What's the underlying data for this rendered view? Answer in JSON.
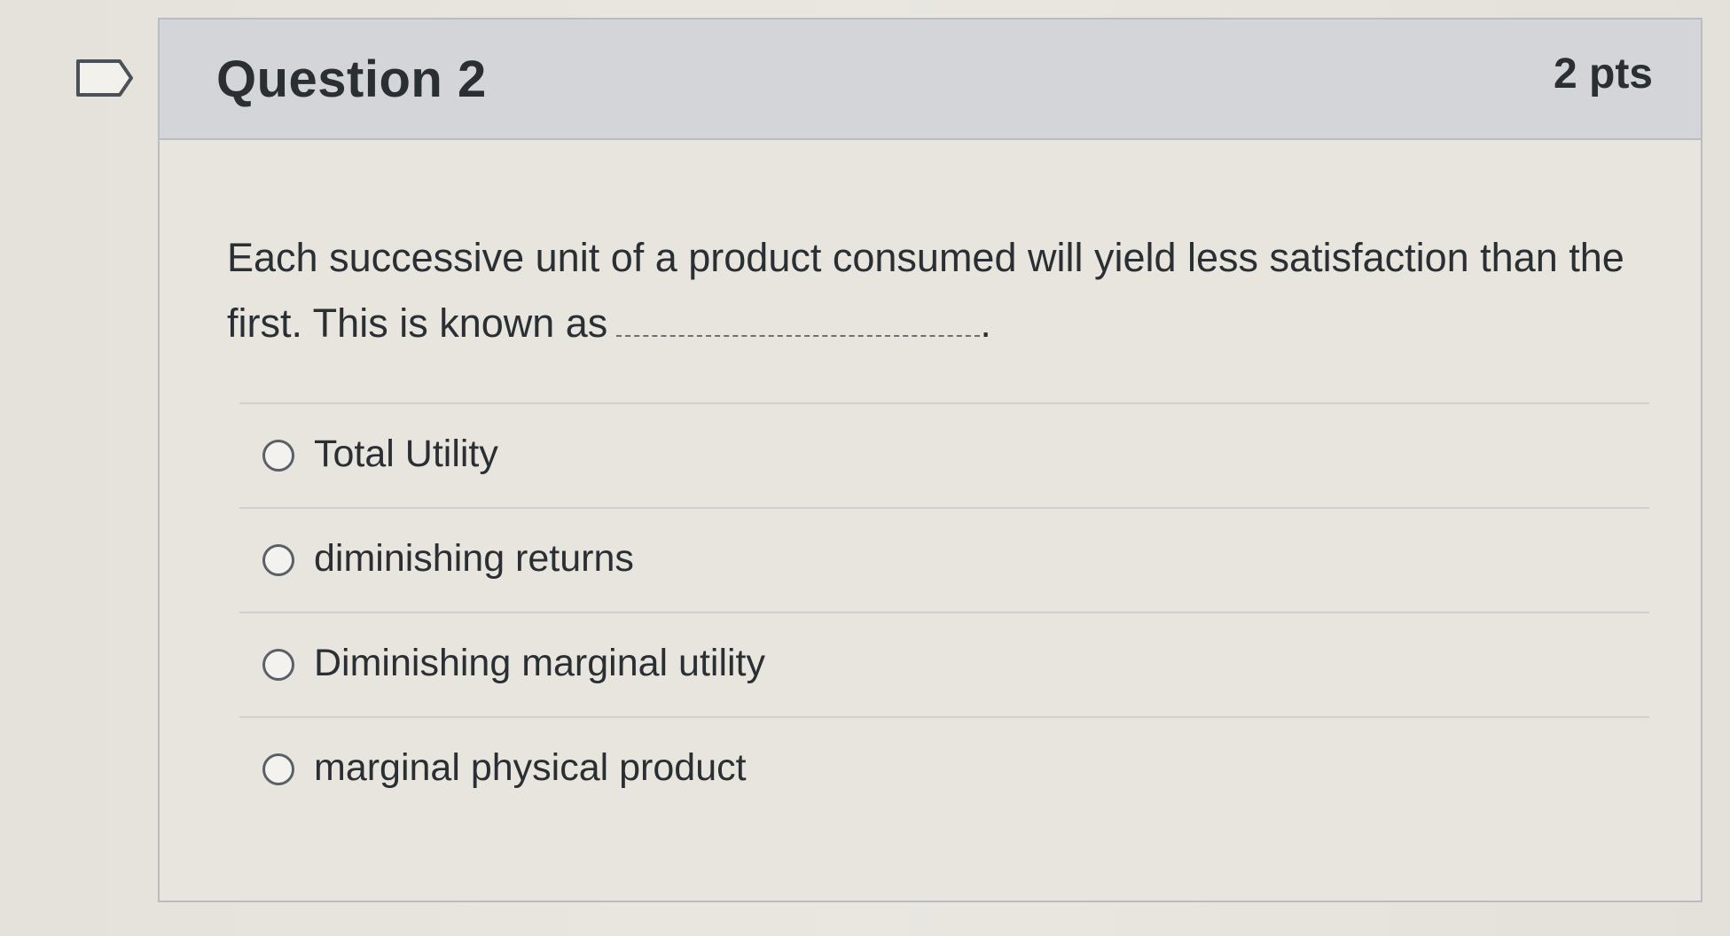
{
  "question": {
    "title": "Question 2",
    "points": "2 pts",
    "text": "Each successive unit of a product consumed will yield less satisfaction than the first. This is known as",
    "text_suffix": "."
  },
  "answers": [
    {
      "label": "Total Utility",
      "selected": false
    },
    {
      "label": "diminishing returns",
      "selected": false
    },
    {
      "label": "Diminishing marginal utility",
      "selected": false
    },
    {
      "label": "marginal physical product",
      "selected": false
    }
  ],
  "icons": {
    "flag": "flag-question-icon",
    "radio": "radio-button-icon"
  },
  "colors": {
    "header_bg": "#d3d5d8",
    "card_border": "#b9bcc0",
    "text": "#2a2f33"
  }
}
